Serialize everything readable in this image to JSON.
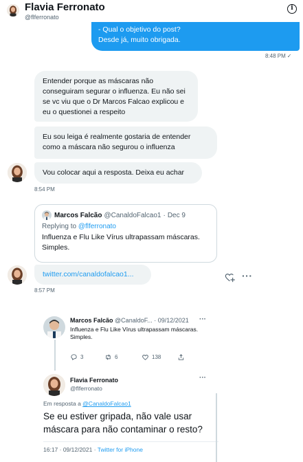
{
  "header": {
    "name": "Flavia Ferronato",
    "handle": "@flferronato",
    "info_glyph": "i"
  },
  "messages": {
    "sent_line1": "- Qual o objetivo do post?",
    "sent_line2": "Desde já, muito obrigada.",
    "sent_time": "8:48 PM",
    "sent_status_glyph": "✓",
    "r1": "Entender porque as máscaras não conseguiram segurar o influenza. Eu não sei se vc viu que o Dr Marcos Falcao explicou e eu o questionei a respeito",
    "r2": "Eu sou leiga é realmente gostaria de entender como a máscara não segurou o influenza",
    "r3": "Vou colocar aqui a resposta. Deixa eu achar",
    "time2": "8:54 PM",
    "link": "twitter.com/canaldofalcao1...",
    "time3": "8:57 PM",
    "more_glyph": "···"
  },
  "quote": {
    "name": "Marcos Falcão",
    "handle": "@CanaldoFalcao1",
    "dot": "·",
    "date": "Dec 9",
    "reply_prefix": "Replying to ",
    "reply_handle": "@flferronato",
    "text": "Influenza e Flu Like Vírus ultrapassam máscaras. Simples."
  },
  "screenshot": {
    "name1": "Marcos Falcão",
    "handle1": "@CanaldoF... · 09/12/2021",
    "more": "···",
    "text1": "Influenza e Flu Like Vírus ultrapassam máscaras.",
    "text1b": "Simples.",
    "replies": "3",
    "retweets": "6",
    "likes": "138",
    "name2": "Flavia Ferronato",
    "handle2": "@flferronato",
    "reply_prefix": "Em resposta a ",
    "reply_handle": "@CanaldoFalcao1",
    "text2": "Se eu estiver gripada, não vale usar máscara para não contaminar o resto?",
    "meta_prefix": "16:17 · 09/12/2021 · ",
    "meta_source": "Twitter for iPhone"
  },
  "colors": {
    "accent": "#1d9bf0",
    "bubble_received": "#eff3f4",
    "muted": "#536471"
  }
}
